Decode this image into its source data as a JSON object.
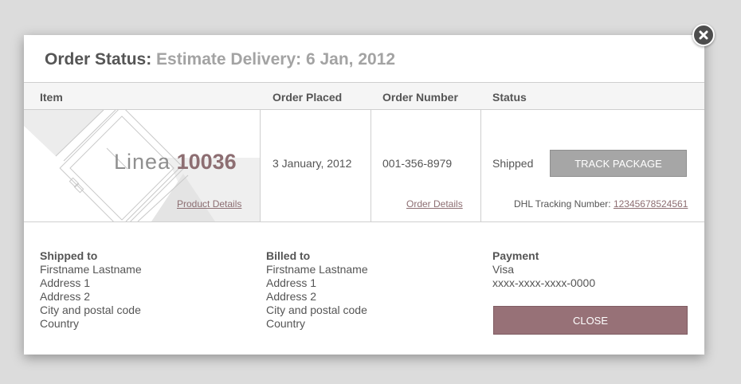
{
  "modal": {
    "title_label": "Order Status:",
    "title_estimate": "Estimate Delivery: 6 Jan, 2012"
  },
  "table": {
    "headers": [
      "Item",
      "Order Placed",
      "Order Number",
      "Status"
    ],
    "row": {
      "product_brand": "Linea",
      "product_number": "10036",
      "product_details_link": "Product Details",
      "order_placed": "3 January, 2012",
      "order_number": "001-356-8979",
      "order_details_link": "Order Details",
      "status": "Shipped",
      "track_button": "TRACK PACKAGE",
      "tracking_label": "DHL Tracking Number:",
      "tracking_number": "12345678524561"
    }
  },
  "shipped_to": {
    "heading": "Shipped to",
    "lines": [
      "Firstname Lastname",
      "Address 1",
      "Address 2",
      "City and postal code",
      "Country"
    ]
  },
  "billed_to": {
    "heading": "Billed to",
    "lines": [
      "Firstname Lastname",
      "Address 1",
      "Address 2",
      "City and postal code",
      "Country"
    ]
  },
  "payment": {
    "heading": "Payment",
    "method": "Visa",
    "card": "xxxx-xxxx-xxxx-0000",
    "close_button": "CLOSE"
  },
  "icons": {
    "close": "close-icon"
  },
  "colors": {
    "accent": "#977177",
    "link": "#8d6e72",
    "track_button": "#a6a6a6"
  }
}
